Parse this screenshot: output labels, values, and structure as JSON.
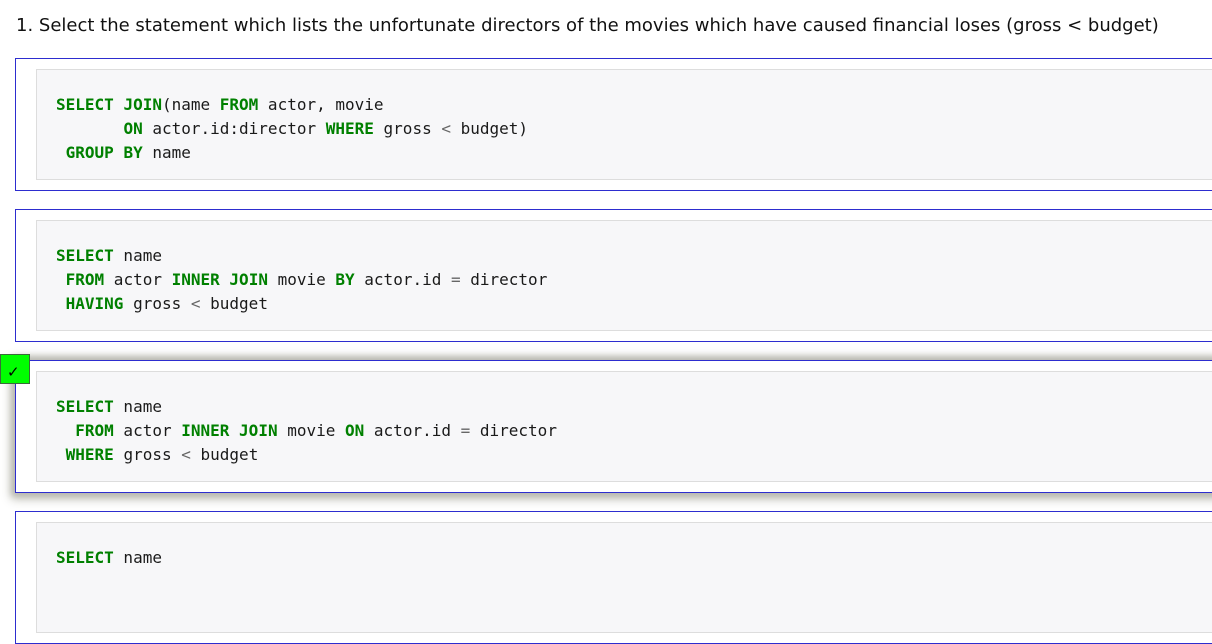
{
  "question": {
    "text": "1. Select the statement which lists the unfortunate directors of the movies which have caused financial loses (gross < budget)"
  },
  "options": [
    {
      "id": "opt1",
      "selected": false,
      "code": [
        "SELECT JOIN(name FROM actor, movie",
        "       ON actor.id:director WHERE gross < budget)",
        " GROUP BY name"
      ]
    },
    {
      "id": "opt2",
      "selected": false,
      "code": [
        "SELECT name",
        " FROM actor INNER JOIN movie BY actor.id = director",
        " HAVING gross < budget"
      ]
    },
    {
      "id": "opt3",
      "selected": true,
      "code": [
        "SELECT name",
        "  FROM actor INNER JOIN movie ON actor.id = director",
        " WHERE gross < budget"
      ]
    },
    {
      "id": "opt4",
      "selected": false,
      "code": [
        "SELECT name"
      ]
    }
  ],
  "correct_mark": {
    "symbol": "✓",
    "color": "#00ff00"
  },
  "sql_keywords": [
    "SELECT",
    "JOIN",
    "FROM",
    "ON",
    "WHERE",
    "GROUP",
    "BY",
    "INNER",
    "HAVING"
  ]
}
